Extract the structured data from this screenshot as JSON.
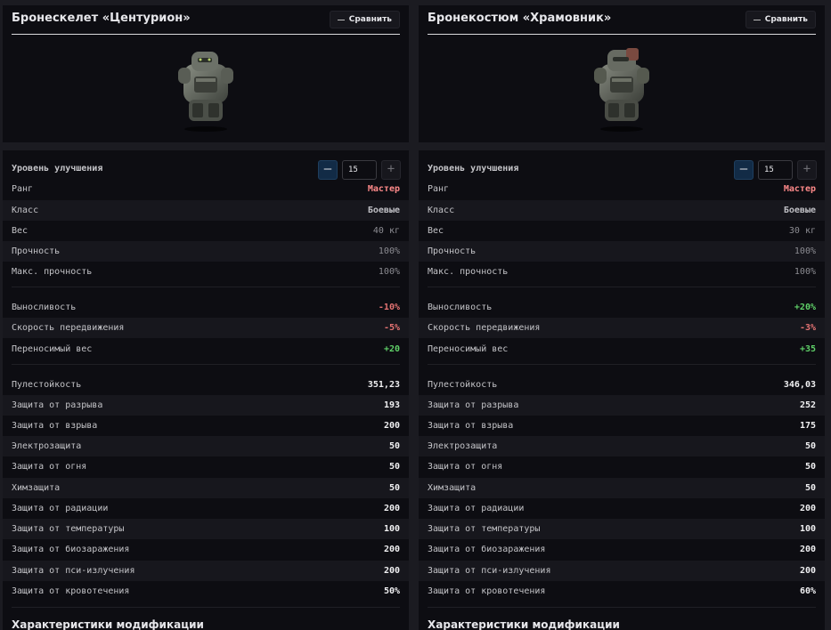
{
  "compare_label": "Сравнить",
  "upgrade_label": "Уровень улучшения",
  "mods_title": "Характеристики модификации",
  "items": [
    {
      "title": "Бронескелет «Центурион»",
      "upgrade_value": "15",
      "rank_label": "Ранг",
      "rank": "Мастер",
      "class_label": "Класс",
      "class": "Боевые",
      "weight_label": "Вес",
      "weight": "40 кг",
      "durability_label": "Прочность",
      "durability": "100%",
      "max_durability_label": "Макс. прочность",
      "max_durability": "100%",
      "stamina_label": "Выносливость",
      "stamina": "-10%",
      "speed_label": "Скорость передвижения",
      "speed": "-5%",
      "carry_label": "Переносимый вес",
      "carry": "+20",
      "bullet_label": "Пулестойкость",
      "bullet": "351,23",
      "tear_label": "Защита от разрыва",
      "tear": "193",
      "explosion_label": "Защита от взрыва",
      "explosion": "200",
      "electro_label": "Электрозащита",
      "electro": "50",
      "fire_label": "Защита от огня",
      "fire": "50",
      "chem_label": "Химзащита",
      "chem": "50",
      "radiation_label": "Защита от радиации",
      "radiation": "200",
      "temperature_label": "Защита от температуры",
      "temperature": "100",
      "bio_label": "Защита от биозаражения",
      "bio": "200",
      "psi_label": "Защита от пси-излучения",
      "psi": "200",
      "bleeding_label": "Защита от кровотечения",
      "bleeding": "50%"
    },
    {
      "title": "Бронекостюм «Храмовник»",
      "upgrade_value": "15",
      "rank_label": "Ранг",
      "rank": "Мастер",
      "class_label": "Класс",
      "class": "Боевые",
      "weight_label": "Вес",
      "weight": "30 кг",
      "durability_label": "Прочность",
      "durability": "100%",
      "max_durability_label": "Макс. прочность",
      "max_durability": "100%",
      "stamina_label": "Выносливость",
      "stamina": "+20%",
      "speed_label": "Скорость передвижения",
      "speed": "-3%",
      "carry_label": "Переносимый вес",
      "carry": "+35",
      "bullet_label": "Пулестойкость",
      "bullet": "346,03",
      "tear_label": "Защита от разрыва",
      "tear": "252",
      "explosion_label": "Защита от взрыва",
      "explosion": "175",
      "electro_label": "Электрозащита",
      "electro": "50",
      "fire_label": "Защита от огня",
      "fire": "50",
      "chem_label": "Химзащита",
      "chem": "50",
      "radiation_label": "Защита от радиации",
      "radiation": "200",
      "temperature_label": "Защита от температуры",
      "temperature": "100",
      "bio_label": "Защита от биозаражения",
      "bio": "200",
      "psi_label": "Защита от пси-излучения",
      "psi": "200",
      "bleeding_label": "Защита от кровотечения",
      "bleeding": "60%"
    }
  ],
  "colors": {
    "rank": "#ff8a8a",
    "negative": "#e57373",
    "positive": "#5fd068",
    "panel_bg": "#0d0d12",
    "minus_button": "#122b46"
  }
}
